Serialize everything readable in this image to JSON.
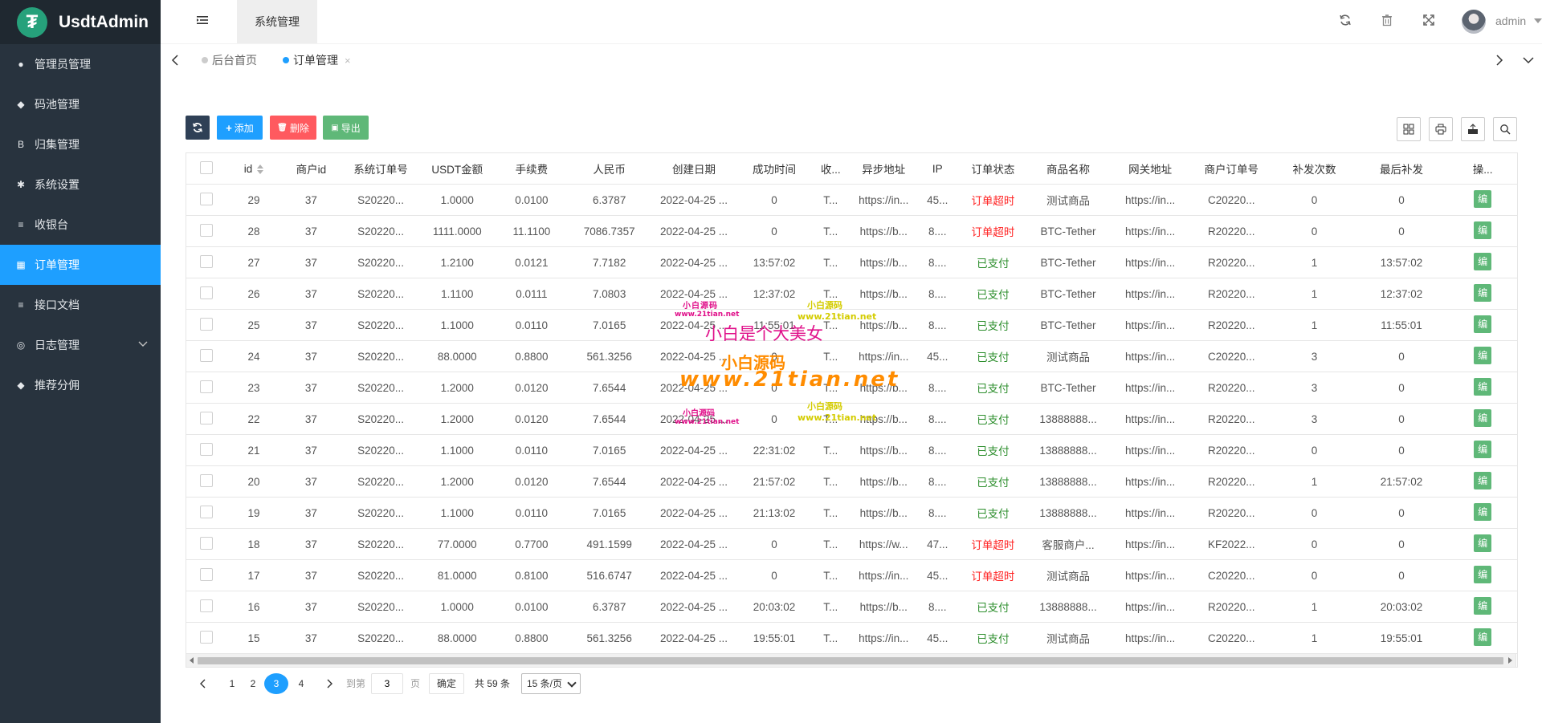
{
  "app": {
    "name": "UsdtAdmin",
    "logo_letter": "₮"
  },
  "sidebar": {
    "items": [
      {
        "label": "管理员管理",
        "icon": "user-icon"
      },
      {
        "label": "码池管理",
        "icon": "android-icon"
      },
      {
        "label": "归集管理",
        "icon": "bitcoin-icon"
      },
      {
        "label": "系统设置",
        "icon": "gear-icon"
      },
      {
        "label": "收银台",
        "icon": "list-icon"
      },
      {
        "label": "订单管理",
        "icon": "calculator-icon",
        "active": true
      },
      {
        "label": "接口文档",
        "icon": "align-icon"
      },
      {
        "label": "日志管理",
        "icon": "log-icon",
        "has_children": true
      },
      {
        "label": "推荐分佣",
        "icon": "android-icon"
      }
    ]
  },
  "header": {
    "top_tab": "系统管理",
    "user": "admin"
  },
  "tabs": [
    {
      "label": "后台首页"
    },
    {
      "label": "订单管理",
      "active": true
    }
  ],
  "toolbar": {
    "add": "添加",
    "delete": "删除",
    "export": "导出"
  },
  "table": {
    "columns": [
      "id",
      "商户id",
      "系统订单号",
      "USDT金额",
      "手续费",
      "人民币",
      "创建日期",
      "成功时间",
      "收...",
      "异步地址",
      "IP",
      "订单状态",
      "商品名称",
      "网关地址",
      "商户订单号",
      "补发次数",
      "最后补发",
      "操..."
    ],
    "rows": [
      [
        "29",
        "37",
        "S20220...",
        "1.0000",
        "0.0100",
        "6.3787",
        "2022-04-25 ...",
        "0",
        "T...",
        "https://in...",
        "45...",
        "订单超时",
        "测试商品",
        "https://in...",
        "C20220...",
        "0",
        "0",
        "编"
      ],
      [
        "28",
        "37",
        "S20220...",
        "1111.0000",
        "11.1100",
        "7086.7357",
        "2022-04-25 ...",
        "0",
        "T...",
        "https://b...",
        "8....",
        "订单超时",
        "BTC-Tether",
        "https://in...",
        "R20220...",
        "0",
        "0",
        "编"
      ],
      [
        "27",
        "37",
        "S20220...",
        "1.2100",
        "0.0121",
        "7.7182",
        "2022-04-25 ...",
        "13:57:02",
        "T...",
        "https://b...",
        "8....",
        "已支付",
        "BTC-Tether",
        "https://in...",
        "R20220...",
        "1",
        "13:57:02",
        "编"
      ],
      [
        "26",
        "37",
        "S20220...",
        "1.1100",
        "0.0111",
        "7.0803",
        "2022-04-25 ...",
        "12:37:02",
        "T...",
        "https://b...",
        "8....",
        "已支付",
        "BTC-Tether",
        "https://in...",
        "R20220...",
        "1",
        "12:37:02",
        "编"
      ],
      [
        "25",
        "37",
        "S20220...",
        "1.1000",
        "0.0110",
        "7.0165",
        "2022-04-25 ...",
        "11:55:01",
        "T...",
        "https://b...",
        "8....",
        "已支付",
        "BTC-Tether",
        "https://in...",
        "R20220...",
        "1",
        "11:55:01",
        "编"
      ],
      [
        "24",
        "37",
        "S20220...",
        "88.0000",
        "0.8800",
        "561.3256",
        "2022-04-25 ...",
        "0",
        "T...",
        "https://in...",
        "45...",
        "已支付",
        "测试商品",
        "https://in...",
        "C20220...",
        "3",
        "0",
        "编"
      ],
      [
        "23",
        "37",
        "S20220...",
        "1.2000",
        "0.0120",
        "7.6544",
        "2022-04-25 ...",
        "0",
        "T...",
        "https://b...",
        "8....",
        "已支付",
        "BTC-Tether",
        "https://in...",
        "R20220...",
        "3",
        "0",
        "编"
      ],
      [
        "22",
        "37",
        "S20220...",
        "1.2000",
        "0.0120",
        "7.6544",
        "2022-04-25 ...",
        "0",
        "T...",
        "https://b...",
        "8....",
        "已支付",
        "13888888...",
        "https://in...",
        "R20220...",
        "3",
        "0",
        "编"
      ],
      [
        "21",
        "37",
        "S20220...",
        "1.1000",
        "0.0110",
        "7.0165",
        "2022-04-25 ...",
        "22:31:02",
        "T...",
        "https://b...",
        "8....",
        "已支付",
        "13888888...",
        "https://in...",
        "R20220...",
        "0",
        "0",
        "编"
      ],
      [
        "20",
        "37",
        "S20220...",
        "1.2000",
        "0.0120",
        "7.6544",
        "2022-04-25 ...",
        "21:57:02",
        "T...",
        "https://b...",
        "8....",
        "已支付",
        "13888888...",
        "https://in...",
        "R20220...",
        "1",
        "21:57:02",
        "编"
      ],
      [
        "19",
        "37",
        "S20220...",
        "1.1000",
        "0.0110",
        "7.0165",
        "2022-04-25 ...",
        "21:13:02",
        "T...",
        "https://b...",
        "8....",
        "已支付",
        "13888888...",
        "https://in...",
        "R20220...",
        "0",
        "0",
        "编"
      ],
      [
        "18",
        "37",
        "S20220...",
        "77.0000",
        "0.7700",
        "491.1599",
        "2022-04-25 ...",
        "0",
        "T...",
        "https://w...",
        "47...",
        "订单超时",
        "客服商户...",
        "https://in...",
        "KF2022...",
        "0",
        "0",
        "编"
      ],
      [
        "17",
        "37",
        "S20220...",
        "81.0000",
        "0.8100",
        "516.6747",
        "2022-04-25 ...",
        "0",
        "T...",
        "https://in...",
        "45...",
        "订单超时",
        "测试商品",
        "https://in...",
        "C20220...",
        "0",
        "0",
        "编"
      ],
      [
        "16",
        "37",
        "S20220...",
        "1.0000",
        "0.0100",
        "6.3787",
        "2022-04-25 ...",
        "20:03:02",
        "T...",
        "https://b...",
        "8....",
        "已支付",
        "13888888...",
        "https://in...",
        "R20220...",
        "1",
        "20:03:02",
        "编"
      ],
      [
        "15",
        "37",
        "S20220...",
        "88.0000",
        "0.8800",
        "561.3256",
        "2022-04-25 ...",
        "19:55:01",
        "T...",
        "https://in...",
        "45...",
        "已支付",
        "测试商品",
        "https://in...",
        "C20220...",
        "1",
        "19:55:01",
        "编"
      ]
    ]
  },
  "pager": {
    "pages": [
      "1",
      "2",
      "3",
      "4"
    ],
    "current": "3",
    "goto_label": "到第",
    "goto_value": "3",
    "page_unit": "页",
    "confirm": "确定",
    "total": "共 59 条",
    "page_size": "15 条/页"
  },
  "watermark": {
    "small_cn": "小白源码",
    "small_url": "www.21tian.net",
    "big_cn": "小白是个大美女",
    "big_brand": "小白源码",
    "big_url": "www.21tian.net"
  }
}
